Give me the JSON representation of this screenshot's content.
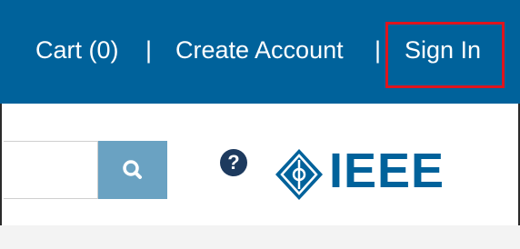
{
  "nav": {
    "cart_label": "Cart (0)",
    "separator": "|",
    "create_account_label": "Create Account",
    "sign_in_label": "Sign In"
  },
  "search": {
    "value": "",
    "button_icon": "search-icon"
  },
  "help": {
    "icon": "help-icon",
    "glyph": "?"
  },
  "logo": {
    "text": "IEEE",
    "icon": "ieee-diamond-icon"
  },
  "colors": {
    "topbar": "#00629b",
    "search_button": "#6aa2c2",
    "highlight": "#e0141e",
    "logo": "#00629b"
  }
}
